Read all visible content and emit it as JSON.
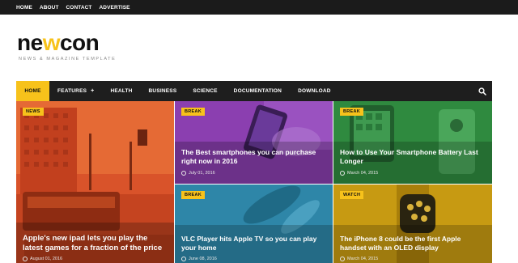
{
  "top_links": [
    "HOME",
    "ABOUT",
    "CONTACT",
    "ADVERTISE"
  ],
  "logo": {
    "name_part1": "ne",
    "name_w": "w",
    "name_part2": "con",
    "tagline": "NEWS & MAGAZINE TEMPLATE"
  },
  "nav": {
    "items": [
      "HOME",
      "FEATURES",
      "HEALTH",
      "BUSINESS",
      "SCIENCE",
      "DOCUMENTATION",
      "DOWNLOAD"
    ],
    "features_plus": "+",
    "search_icon": "search-icon"
  },
  "colors": {
    "accent": "#f7c21b",
    "topbar": "#1b1b1b",
    "nav": "#1e1e1e"
  },
  "posts": [
    {
      "badge": "NEWS",
      "title": "Apple's new ipad lets you play the latest games for a fraction of the price",
      "date": "August 01, 2016",
      "overlay": "#e0552a"
    },
    {
      "badge": "BREAK",
      "title": "The Best smartphones you can purchase right now in 2016",
      "date": "July 01, 2016",
      "overlay": "#8b3fb0"
    },
    {
      "badge": "BREAK",
      "title": "How to Use Your Smartphone Battery Last Longer",
      "date": "March 04, 2015",
      "overlay": "#2f8a3f"
    },
    {
      "badge": "BREAK",
      "title": "VLC Player hits Apple TV so you can play your home",
      "date": "June 08, 2016",
      "overlay": "#2e86a8"
    },
    {
      "badge": "WATCH",
      "title": "The iPhone 8 could be the first Apple handset with an OLED display",
      "date": "March 04, 2015",
      "overlay": "#c79a12"
    }
  ]
}
